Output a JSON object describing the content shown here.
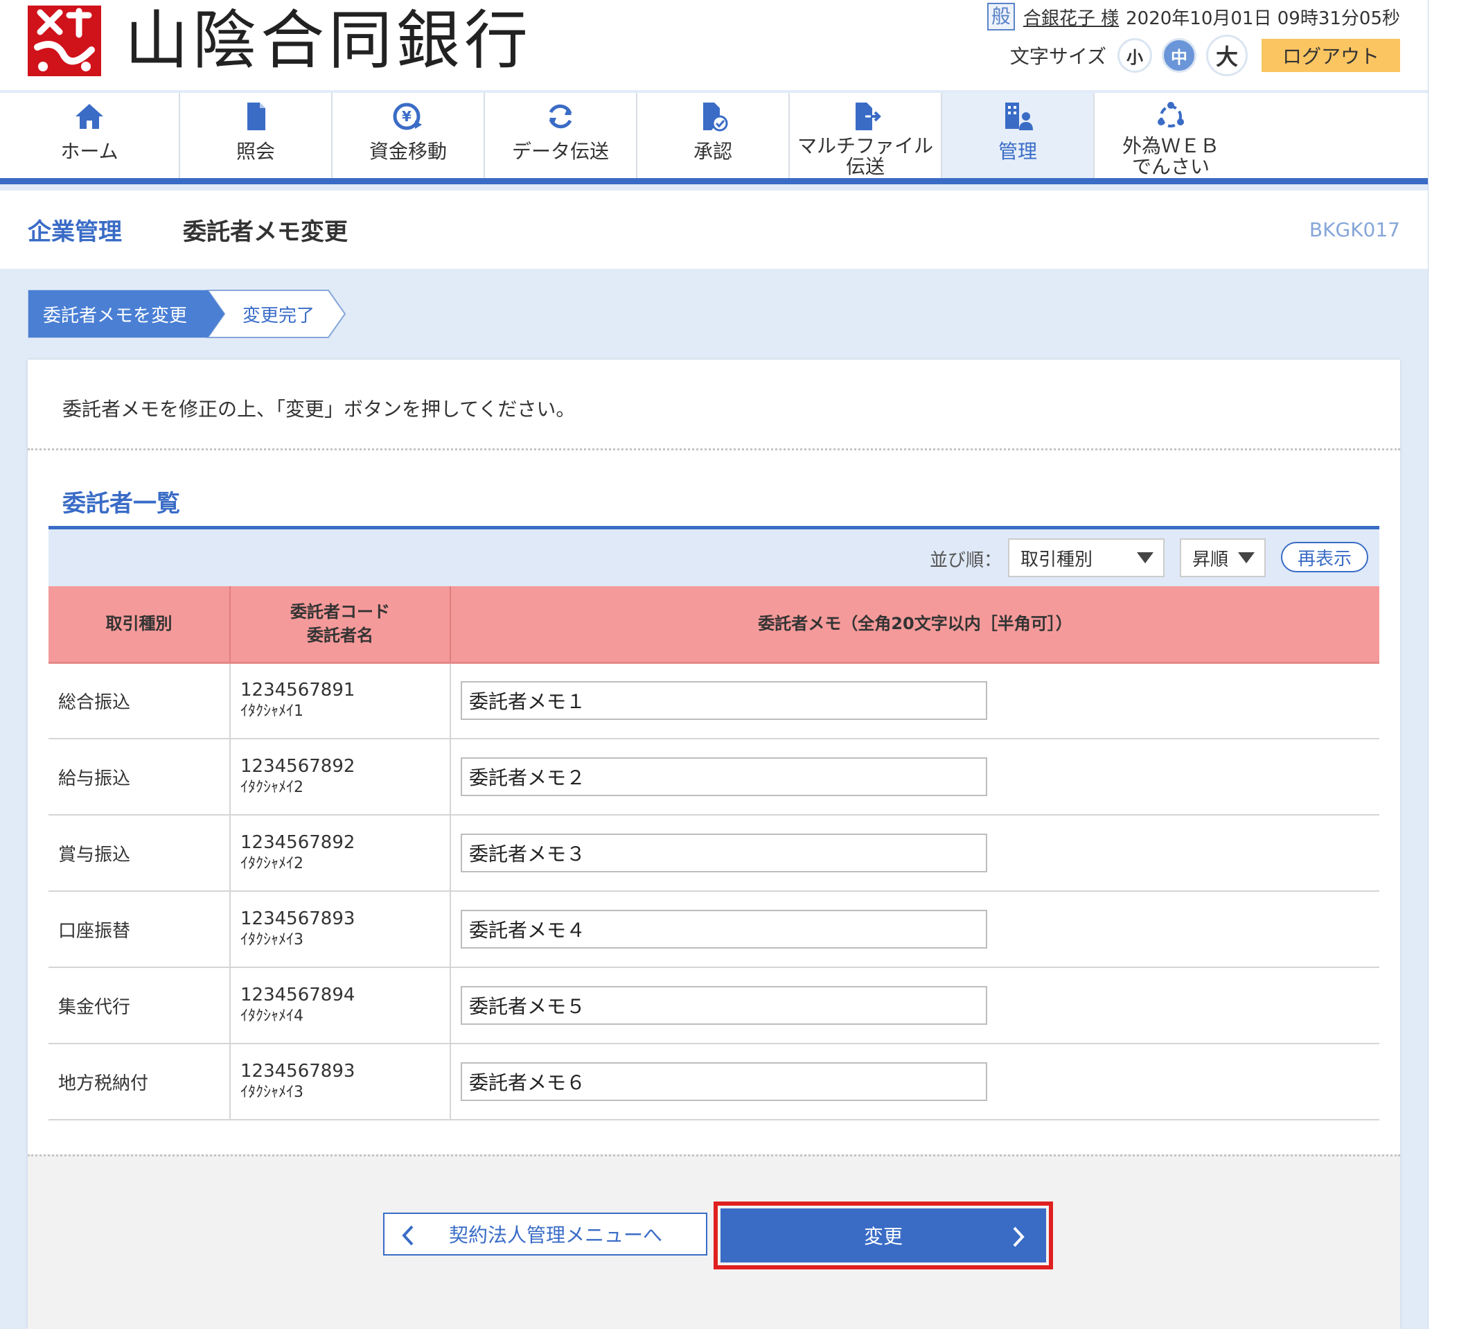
{
  "bank": {
    "name": "山陰合同銀行"
  },
  "user": {
    "kind_badge": "般",
    "name": "合銀花子 様",
    "datetime": "2020年10月01日 09時31分05秒"
  },
  "font_size": {
    "label": "文字サイズ",
    "small": "小",
    "medium": "中",
    "large": "大",
    "selected": "中"
  },
  "logout_label": "ログアウト",
  "nav": [
    {
      "label": "ホーム",
      "icon": "home-icon"
    },
    {
      "label": "照会",
      "icon": "document-icon"
    },
    {
      "label": "資金移動",
      "icon": "yen-transfer-icon"
    },
    {
      "label": "データ伝送",
      "icon": "refresh-icon"
    },
    {
      "label": "承認",
      "icon": "approve-document-icon"
    },
    {
      "label_line1": "マルチファイル",
      "label_line2": "伝送",
      "icon": "file-send-icon"
    },
    {
      "label": "管理",
      "icon": "building-user-icon",
      "active": true
    },
    {
      "label_line1": "外為ＷＥＢ",
      "label_line2": "でんさい",
      "icon": "network-icon"
    }
  ],
  "page": {
    "category": "企業管理",
    "title": "委託者メモ変更",
    "screen_id": "BKGK017"
  },
  "steps": [
    {
      "label": "委託者メモを変更",
      "current": true
    },
    {
      "label": "変更完了",
      "current": false
    }
  ],
  "instruction": "委託者メモを修正の上、「変更」ボタンを押してください。",
  "section_title": "委託者一覧",
  "sort": {
    "label": "並び順：",
    "field_value": "取引種別",
    "order_value": "昇順",
    "redisplay_label": "再表示"
  },
  "table": {
    "headers": {
      "type": "取引種別",
      "code_line1": "委託者コード",
      "code_line2": "委託者名",
      "memo": "委託者メモ（全角20文字以内［半角可］）"
    },
    "rows": [
      {
        "type": "総合振込",
        "code": "1234567891",
        "name": "ｲﾀｸｼｬﾒｲ1",
        "memo": "委託者メモ１"
      },
      {
        "type": "給与振込",
        "code": "1234567892",
        "name": "ｲﾀｸｼｬﾒｲ2",
        "memo": "委託者メモ２"
      },
      {
        "type": "賞与振込",
        "code": "1234567892",
        "name": "ｲﾀｸｼｬﾒｲ2",
        "memo": "委託者メモ３"
      },
      {
        "type": "口座振替",
        "code": "1234567893",
        "name": "ｲﾀｸｼｬﾒｲ3",
        "memo": "委託者メモ４"
      },
      {
        "type": "集金代行",
        "code": "1234567894",
        "name": "ｲﾀｸｼｬﾒｲ4",
        "memo": "委託者メモ５"
      },
      {
        "type": "地方税納付",
        "code": "1234567893",
        "name": "ｲﾀｸｼｬﾒｲ3",
        "memo": "委託者メモ６"
      }
    ]
  },
  "buttons": {
    "back_label": "契約法人管理メニューへ",
    "change_label": "変更"
  },
  "colors": {
    "primary": "#3a6cc6",
    "header_red": "#f59a9a",
    "logout_yellow": "#fbc562",
    "highlight_red": "#e02020",
    "logo_red": "#d0121b"
  }
}
